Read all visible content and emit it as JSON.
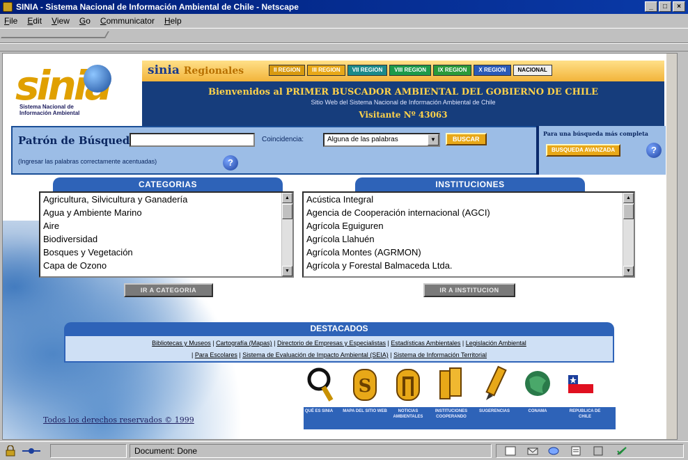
{
  "window": {
    "title": "SINIA - Sistema Nacional de Información Ambiental de Chile - Netscape"
  },
  "menu": [
    "File",
    "Edit",
    "View",
    "Go",
    "Communicator",
    "Help"
  ],
  "logo": {
    "word": "sinia",
    "sub1": "Sistema Nacional de",
    "sub2": "Información Ambiental"
  },
  "header": {
    "regionales_prefix": "sinia",
    "regionales_suffix": "Regionales",
    "regions": [
      {
        "label": "II REGION",
        "color": "#d89a10"
      },
      {
        "label": "III REGION",
        "color": "#e8a818"
      },
      {
        "label": "VII REGION",
        "color": "#1c8a8a"
      },
      {
        "label": "VIII REGION",
        "color": "#1c9a4a"
      },
      {
        "label": "IX REGION",
        "color": "#2a9a3a"
      },
      {
        "label": "X REGION",
        "color": "#2a5ab8"
      },
      {
        "label": "NACIONAL",
        "color": "#f0f0f0"
      }
    ],
    "welcome": "Bienvenidos al PRIMER BUSCADOR AMBIENTAL DEL GOBIERNO DE CHILE",
    "subtitle": "Sitio Web del Sistema Nacional de Información Ambiental de Chile",
    "visitor": "Visitante Nº 43063"
  },
  "search": {
    "label": "Patrón de Búsqueda:",
    "value": "",
    "coincidence_label": "Coincidencia:",
    "coincidence_selected": "Alguna de las palabras",
    "search_button": "BUSCAR",
    "hint": "(Ingresar las palabras correctamente acentuadas)",
    "advanced_label": "Para una búsqueda más completa",
    "advanced_button": "BUSQUEDA AVANZADA"
  },
  "categorias": {
    "title": "CATEGORIAS",
    "items": [
      "Agricultura, Silvicultura y Ganadería",
      "Agua y Ambiente Marino",
      "Aire",
      "Biodiversidad",
      "Bosques y Vegetación",
      "Capa de Ozono"
    ],
    "go_button": "IR A CATEGORIA"
  },
  "instituciones": {
    "title": "INSTITUCIONES",
    "items": [
      "Acústica Integral",
      "Agencia de Cooperación internacional (AGCI)",
      "Agrícola Eguiguren",
      "Agrícola Llahuén",
      "Agrícola Montes (AGRMON)",
      "Agrícola y Forestal Balmaceda Ltda."
    ],
    "go_button": "IR A INSTITUCION"
  },
  "destacados": {
    "title": "DESTACADOS",
    "links_line1": [
      "Bibliotecas y Museos",
      "Cartografía (Mapas)",
      "Directorio de Empresas y Especialistas",
      "Estadísticas Ambientales",
      "Legislación Ambiental"
    ],
    "links_line2": [
      "Para Escolares",
      "Sistema de Evaluación de Impacto Ambiental (SEIA)",
      "Sistema de Información Territorial"
    ]
  },
  "icons": [
    {
      "name": "que-es-sinia",
      "label": "QUÉ ES SINIA"
    },
    {
      "name": "mapa-del-sitio",
      "label": "MAPA DEL SITIO WEB"
    },
    {
      "name": "noticias",
      "label": "NOTICIAS AMBIENTALES"
    },
    {
      "name": "instituciones-cooperando",
      "label": "INSTITUCIONES COOPERANDO"
    },
    {
      "name": "sugerencias",
      "label": "SUGERENCIAS"
    },
    {
      "name": "conama",
      "label": "CONAMA"
    },
    {
      "name": "republica",
      "label": "REPUBLICA DE CHILE"
    }
  ],
  "footer": "Todos los derechos reservados © 1999",
  "status": {
    "text": "Document: Done"
  }
}
